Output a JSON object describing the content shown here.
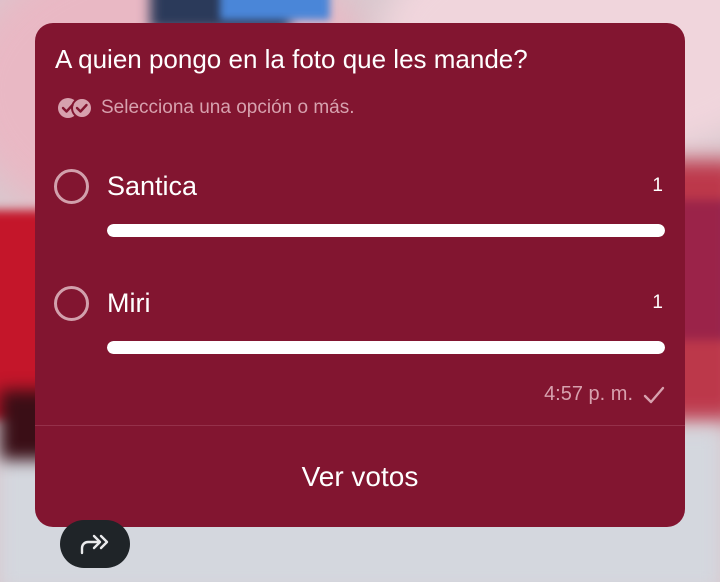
{
  "poll": {
    "question": "A quien pongo en la foto que les mande?",
    "hint": "Selecciona una opción o más.",
    "options": [
      {
        "label": "Santica",
        "count": "1",
        "fraction": 1.0
      },
      {
        "label": "Miri",
        "count": "1",
        "fraction": 1.0
      }
    ],
    "timestamp": "4:57 p. m.",
    "view_votes_label": "Ver votos"
  },
  "icons": {
    "hint": "double-check-badge-icon",
    "sent_status": "single-check-icon",
    "forward": "forward-icon"
  },
  "colors": {
    "card_background": "#821530",
    "muted_text": "#d7a1ae",
    "bar_fill": "#ffffff"
  }
}
